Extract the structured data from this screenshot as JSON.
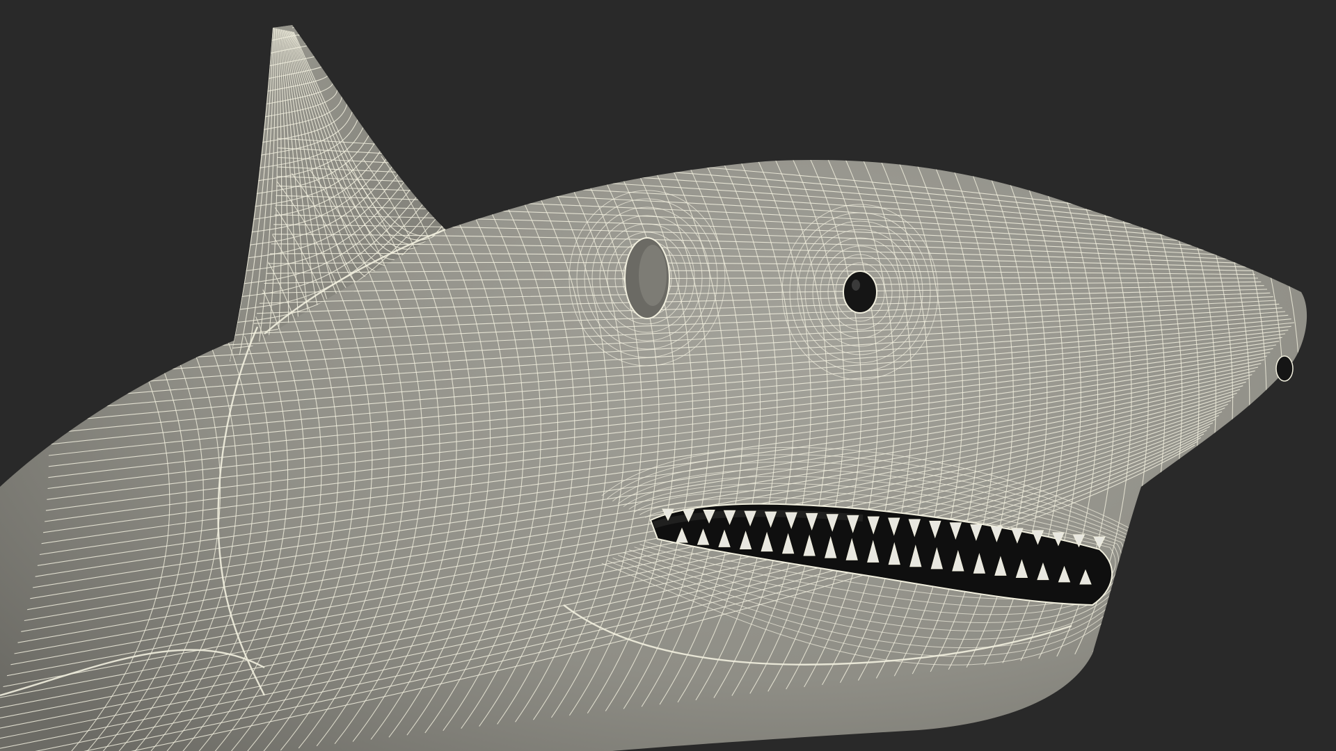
{
  "scene": {
    "subject": "shark-head-wireframe-render",
    "colors": {
      "background": "#292929",
      "surface": "#8f8e86",
      "surface_shadow": "#6f6e68",
      "surface_light": "#a4a39b",
      "wire": "#f2f0df",
      "mouth_interior": "#111111",
      "eye": "#151515",
      "tooth": "#e8e7e0"
    }
  }
}
